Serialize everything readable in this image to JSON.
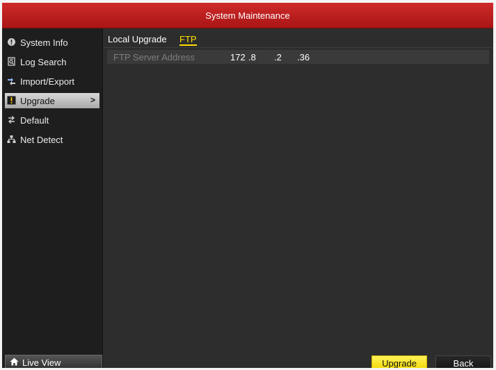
{
  "window": {
    "title": "System Maintenance"
  },
  "sidebar": {
    "items": [
      {
        "label": "System Info",
        "icon": "info-icon"
      },
      {
        "label": "Log Search",
        "icon": "log-search-icon"
      },
      {
        "label": "Import/Export",
        "icon": "import-export-icon"
      },
      {
        "label": "Upgrade",
        "icon": "upgrade-icon",
        "active": true,
        "chevron": ">"
      },
      {
        "label": "Default",
        "icon": "default-icon"
      },
      {
        "label": "Net Detect",
        "icon": "net-detect-icon"
      }
    ],
    "live_view": {
      "label": "Live View",
      "icon": "home-icon"
    }
  },
  "tabs": [
    {
      "label": "Local Upgrade",
      "active": false
    },
    {
      "label": "FTP",
      "active": true
    }
  ],
  "ftp": {
    "server_label": "FTP Server Address",
    "ip": {
      "o1": "172",
      "o2": ".8",
      "o3": ".2",
      "o4": ".36"
    }
  },
  "buttons": {
    "upgrade": "Upgrade",
    "back": "Back"
  },
  "colors": {
    "title_bar": "#c31f1f",
    "accent": "#ffe000",
    "panel": "#2d2d2d",
    "sidebar": "#1e1e1e"
  }
}
